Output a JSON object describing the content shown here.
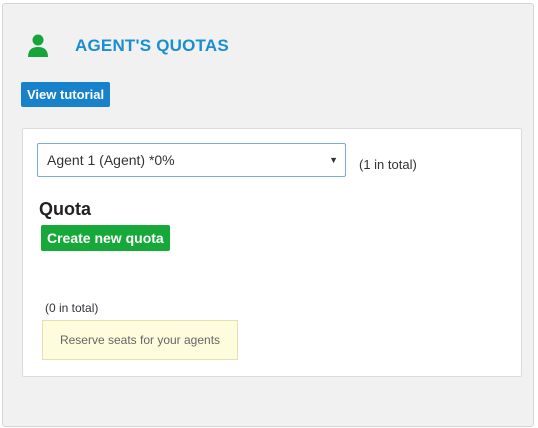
{
  "header": {
    "icon": "user-icon",
    "accent_color": "#16a53a",
    "title": "AGENT'S QUOTAS"
  },
  "tutorial_button": {
    "label": "View tutorial",
    "color": "#1781c9"
  },
  "agent_select": {
    "selected": "Agent 1 (Agent) *0%",
    "arrow_icon": "dropdown-arrow-icon"
  },
  "agents_total": "(1 in total)",
  "quota": {
    "heading": "Quota",
    "create_button": "Create new quota",
    "create_color": "#17a83a",
    "total": "(0 in total)",
    "hint": "Reserve seats for your agents"
  }
}
